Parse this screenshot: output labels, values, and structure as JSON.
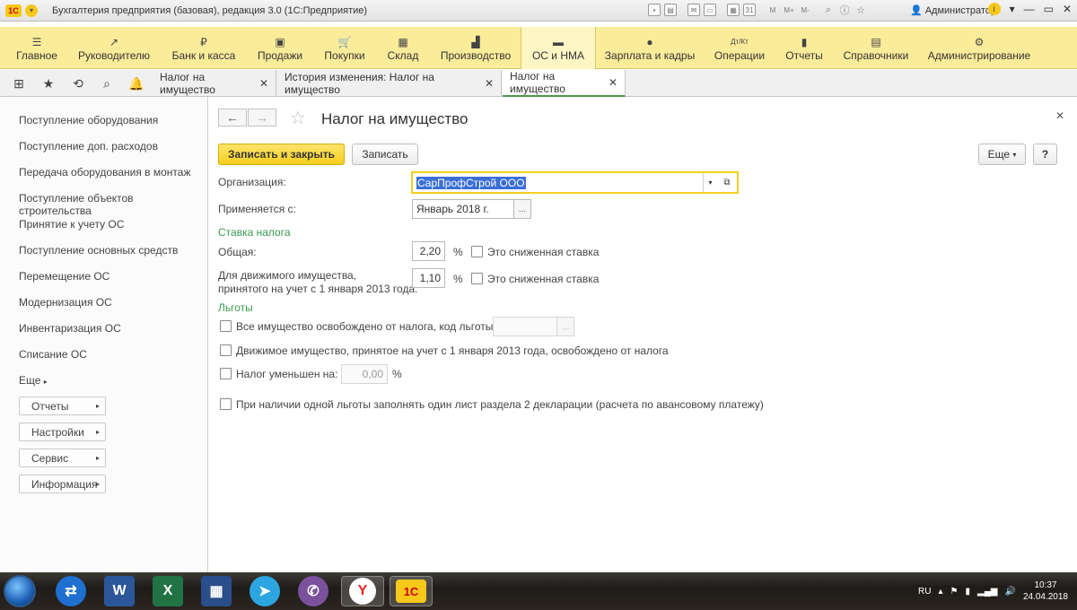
{
  "window": {
    "title": "Бухгалтерия предприятия (базовая), редакция 3.0  (1С:Предприятие)",
    "user": "Администратор",
    "toolbar_icons": [
      "save-icon",
      "print-icon",
      "mail-icon",
      "document-icon",
      "calculator-icon",
      "calendar-icon",
      "m-icon",
      "m-plus-icon",
      "m-minus-icon",
      "search-icon",
      "info-icon",
      "star-icon",
      "user-icon"
    ]
  },
  "sections": [
    {
      "label": "Главное",
      "icon": "menu-icon"
    },
    {
      "label": "Руководителю",
      "icon": "chart-icon"
    },
    {
      "label": "Банк и касса",
      "icon": "ruble-icon"
    },
    {
      "label": "Продажи",
      "icon": "bag-icon"
    },
    {
      "label": "Покупки",
      "icon": "cart-icon"
    },
    {
      "label": "Склад",
      "icon": "warehouse-icon"
    },
    {
      "label": "Производство",
      "icon": "factory-icon"
    },
    {
      "label": "ОС и НМА",
      "icon": "truck-icon"
    },
    {
      "label": "Зарплата и кадры",
      "icon": "person-icon"
    },
    {
      "label": "Операции",
      "icon": "dt-kt-icon"
    },
    {
      "label": "Отчеты",
      "icon": "bar-chart-icon"
    },
    {
      "label": "Справочники",
      "icon": "books-icon"
    },
    {
      "label": "Администрирование",
      "icon": "gear-icon"
    }
  ],
  "tabs": [
    {
      "label": "Налог на имущество"
    },
    {
      "label": "История изменения: Налог на имущество"
    },
    {
      "label": "Налог на имущество"
    }
  ],
  "sidebar": {
    "items": [
      "Поступление оборудования",
      "Поступление доп. расходов",
      "Передача оборудования в монтаж",
      "Поступление объектов строительства",
      "Принятие к учету ОС",
      "Поступление основных средств",
      "Перемещение ОС",
      "Модернизация ОС",
      "Инвентаризация ОС",
      "Списание ОС"
    ],
    "more": "Еще",
    "buttons": [
      "Отчеты",
      "Настройки",
      "Сервис",
      "Информация"
    ]
  },
  "form": {
    "title": "Налог на имущество",
    "save_close": "Записать и закрыть",
    "save": "Записать",
    "more": "Еще",
    "help": "?",
    "organization_label": "Организация:",
    "organization_value": "СарПрофСтрой ООО",
    "applies_label": "Применяется с:",
    "applies_value": "Январь 2018 г.",
    "rate_group": "Ставка налога",
    "general_label": "Общая:",
    "general_value": "2,20",
    "percent": "%",
    "reduced_rate": "Это сниженная ставка",
    "movable_label_1": "Для движимого имущества,",
    "movable_label_2": "принятого на учет с 1 января 2013 года:",
    "movable_value": "1,10",
    "benefits_group": "Льготы",
    "benefit_all": "Все имущество освобождено от налога, код льготы:",
    "benefit_movable": "Движимое имущество, принятое на учет с 1 января 2013 года, освобождено от налога",
    "benefit_reduced": "Налог уменьшен на:",
    "benefit_reduced_value": "0,00",
    "benefit_one_sheet": "При наличии одной льготы заполнять один лист раздела 2 декларации (расчета по авансовому платежу)"
  },
  "taskbar": {
    "apps": [
      "TeamViewer",
      "Word",
      "Excel",
      "Application",
      "Telegram",
      "Viber",
      "Yandex",
      "1С"
    ],
    "lang": "RU",
    "time": "10:37",
    "date": "24.04.2018"
  }
}
